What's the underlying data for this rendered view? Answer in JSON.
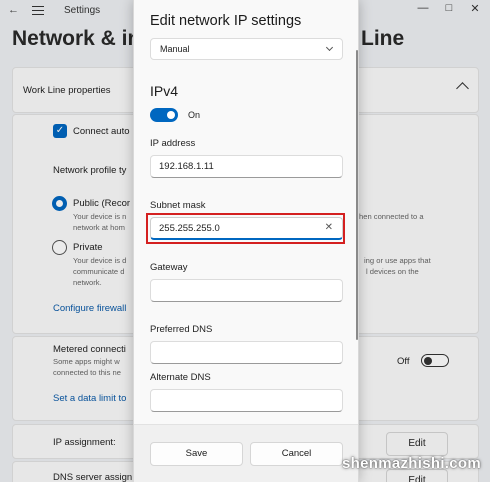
{
  "app": {
    "title": "Settings"
  },
  "page": {
    "heading_start": "Network & in",
    "heading_end": "Line"
  },
  "background": {
    "section_title": "Work Line properties",
    "connect_auto": "Connect auto",
    "network_profile": "Network profile ty",
    "public_label": "Public (Recor",
    "public_desc_1": "Your device is n",
    "public_desc_2": "network at hom",
    "public_right": "hen connected to a",
    "private_label": "Private",
    "private_desc_1": "Your device is d",
    "private_desc_2": "communicate d",
    "private_desc_3": "network.",
    "private_right_1": "ing or use apps that",
    "private_right_2": "l devices on the",
    "firewall_link": "Configure firewall",
    "metered_label": "Metered connecti",
    "metered_desc_1": "Some apps might w",
    "metered_desc_2": "connected to this ne",
    "metered_state": "Off",
    "data_limit_link": "Set a data limit to",
    "ip_assignment": "IP assignment:",
    "dns_assignment": "DNS server assign",
    "edit_button": "Edit",
    "edit_button_2": "Edit"
  },
  "dialog": {
    "title": "Edit network IP settings",
    "mode": "Manual",
    "section": "IPv4",
    "toggle_state": "On",
    "ip_label": "IP address",
    "ip_value": "192.168.1.11",
    "subnet_label": "Subnet mask",
    "subnet_value": "255.255.255.0",
    "gateway_label": "Gateway",
    "gateway_value": "",
    "pref_dns_label": "Preferred DNS",
    "pref_dns_value": "",
    "alt_dns_label": "Alternate DNS",
    "alt_dns_value": "",
    "save": "Save",
    "cancel": "Cancel"
  },
  "watermark": "shenmazhishi.com",
  "colors": {
    "accent": "#0067c0",
    "highlight": "#d42020"
  }
}
